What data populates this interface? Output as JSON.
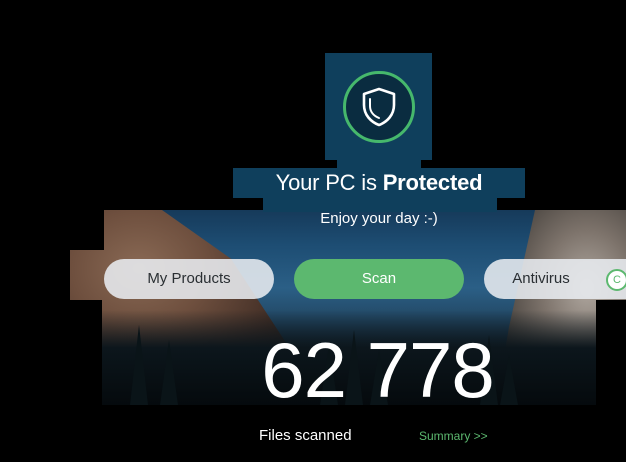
{
  "status": {
    "prefix": "Your PC is ",
    "emphasis": "Protected",
    "subtitle": "Enjoy your day :-)",
    "icon": "shield-icon",
    "accent_color": "#5cb86f",
    "panel_color": "#0f3f5c"
  },
  "actions": {
    "my_products": "My Products",
    "scan": "Scan",
    "antivirus": "Antivirus",
    "antivirus_badge": "C"
  },
  "stats": {
    "files_count": "62 778",
    "files_label": "Files scanned",
    "summary_link": "Summary >>"
  }
}
